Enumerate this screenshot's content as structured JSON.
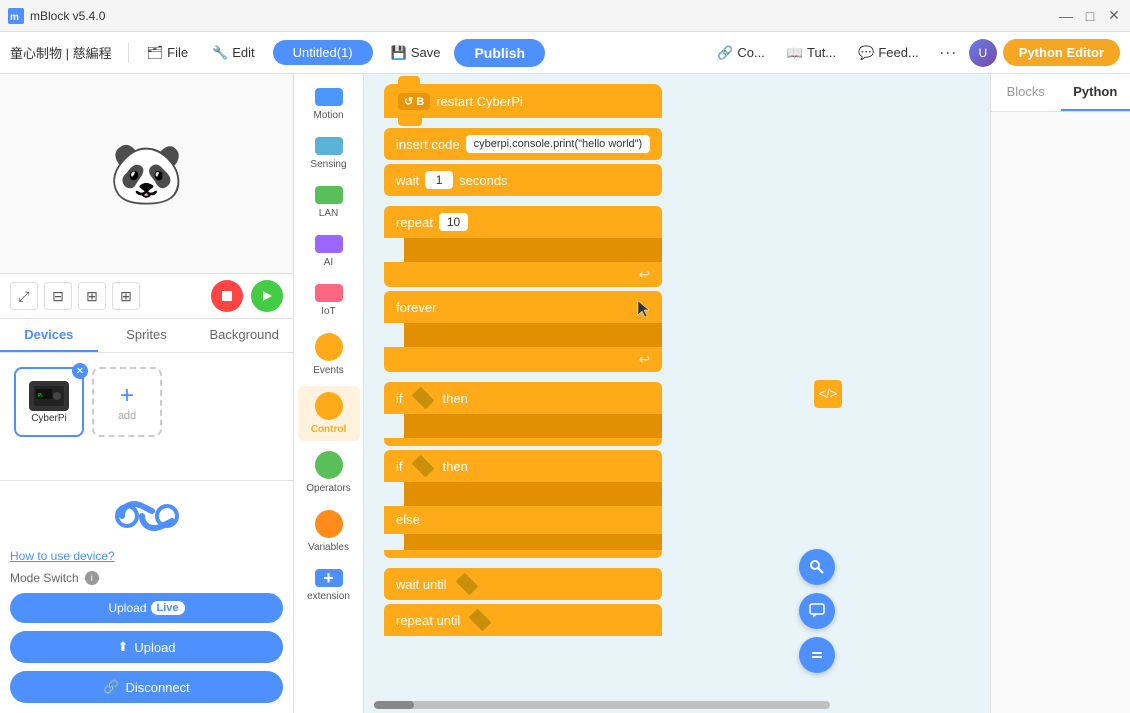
{
  "app": {
    "title": "mBlock v5.4.0",
    "version": "v5.4.0"
  },
  "titlebar": {
    "minimize": "—",
    "maximize": "□",
    "close": "✕"
  },
  "menubar": {
    "brand": "童心制物 | 慈編程",
    "file": "File",
    "edit": "Edit",
    "project_name": "Untitled(1)",
    "save": "Save",
    "publish": "Publish",
    "connect": "Co...",
    "tutorials": "Tut...",
    "feedback": "Feed...",
    "more": "···",
    "python_editor": "Python Editor"
  },
  "stage": {
    "panda": "🐼"
  },
  "tabs": {
    "devices": "Devices",
    "sprites": "Sprites",
    "background": "Background"
  },
  "device": {
    "name": "CyberPi",
    "close": "✕"
  },
  "add_device": {
    "label": "add",
    "plus": "+"
  },
  "upload_section": {
    "how_to_use": "How to use device?",
    "mode_switch": "Mode Switch",
    "info": "i",
    "upload_label": "Upload",
    "live_label": "Live",
    "upload_full": "Upload",
    "disconnect": "Disconnect"
  },
  "block_categories": [
    {
      "id": "motion",
      "label": "Motion",
      "type": "rect",
      "color": "#4c97ff"
    },
    {
      "id": "sensing",
      "label": "Sensing",
      "type": "rect",
      "color": "#5cb1d6"
    },
    {
      "id": "lan",
      "label": "LAN",
      "type": "rect",
      "color": "#59c059"
    },
    {
      "id": "ai",
      "label": "AI",
      "type": "rect",
      "color": "#9966ff"
    },
    {
      "id": "iot",
      "label": "IoT",
      "type": "rect",
      "color": "#ff6680"
    },
    {
      "id": "events",
      "label": "Events",
      "type": "circle",
      "color": "#ffab19"
    },
    {
      "id": "control",
      "label": "Control",
      "type": "circle",
      "color": "#ffab19"
    },
    {
      "id": "operators",
      "label": "Operators",
      "type": "circle",
      "color": "#59c059"
    },
    {
      "id": "variables",
      "label": "Variables",
      "type": "circle",
      "color": "#ff8c1a"
    },
    {
      "id": "extension",
      "label": "extension",
      "type": "plus",
      "color": "#4d90fe"
    }
  ],
  "blocks": [
    {
      "id": "restart",
      "text": "restart CyberPi",
      "type": "hat"
    },
    {
      "id": "insert_code",
      "text": "insert code",
      "value": "cyberpi.console.print(\"hello world\")",
      "type": "normal"
    },
    {
      "id": "wait",
      "text1": "wait",
      "value": "1",
      "text2": "seconds",
      "type": "normal"
    },
    {
      "id": "repeat",
      "text": "repeat",
      "value": "10",
      "type": "c-block"
    },
    {
      "id": "forever",
      "text": "forever",
      "type": "c-block"
    },
    {
      "id": "if_then",
      "text1": "if",
      "text2": "then",
      "type": "c-block"
    },
    {
      "id": "if_else",
      "text1": "if",
      "text2": "then",
      "text3": "else",
      "type": "c-block-else"
    },
    {
      "id": "wait_until",
      "text": "wait until",
      "type": "normal"
    },
    {
      "id": "repeat_until",
      "text": "repeat until",
      "type": "c-block"
    }
  ],
  "right_panel": {
    "blocks_tab": "Blocks",
    "python_tab": "Python"
  },
  "fab": {
    "search": "🔍",
    "chat": "💬",
    "equals": "="
  }
}
